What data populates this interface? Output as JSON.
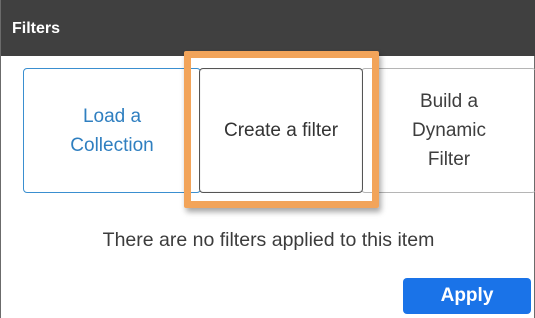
{
  "header": {
    "title": "Filters"
  },
  "options": {
    "load_collection": "Load a\nCollection",
    "create_filter": "Create a filter",
    "build_dynamic": "Build a\nDynamic\nFilter"
  },
  "status": {
    "empty_message": "There are no filters applied to this item"
  },
  "actions": {
    "apply_label": "Apply"
  },
  "colors": {
    "header_bg": "#404040",
    "accent_blue": "#1a73e8",
    "highlight_orange": "#f2a45a"
  }
}
